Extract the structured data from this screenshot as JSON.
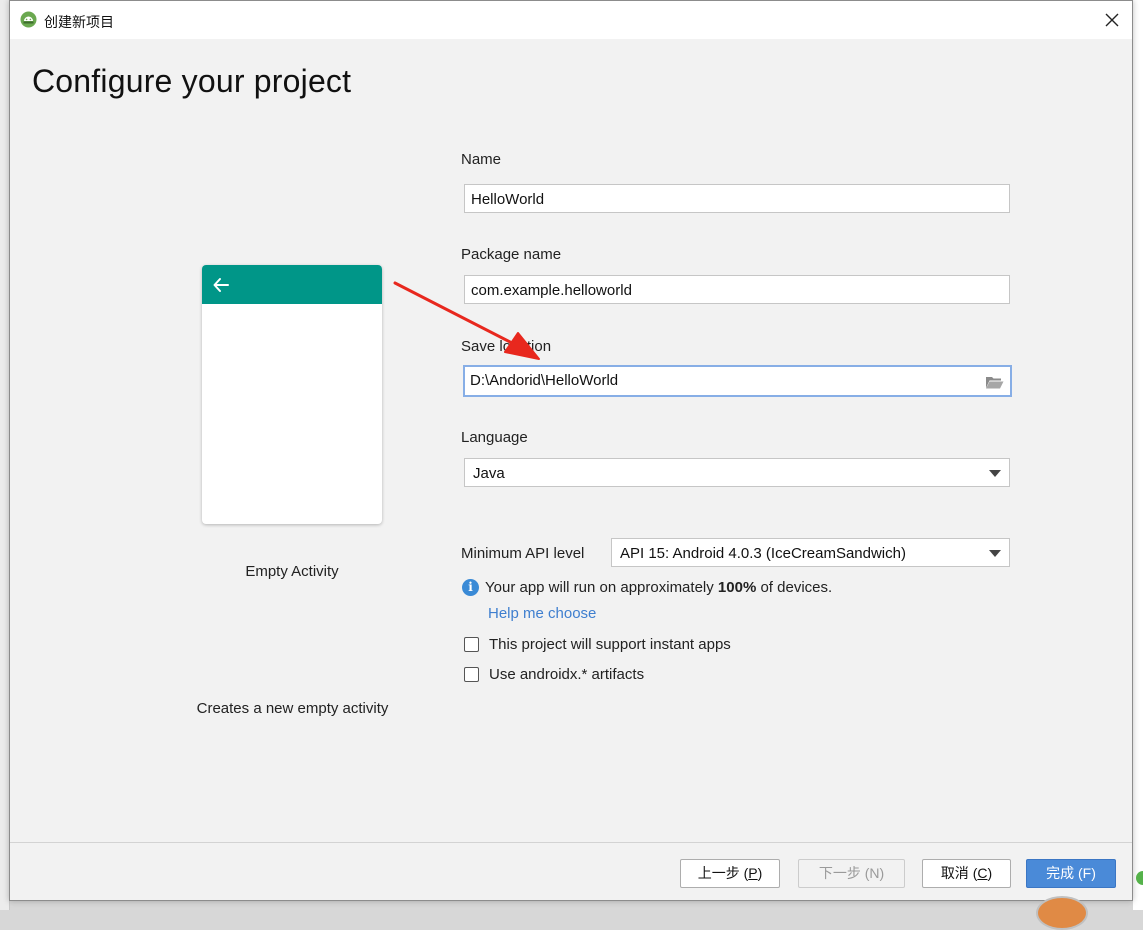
{
  "window": {
    "title": "创建新项目",
    "heading": "Configure your project",
    "close_icon": "close-icon",
    "app_icon": "android-studio-icon"
  },
  "preview": {
    "template_name": "Empty Activity",
    "template_description": "Creates a new empty activity",
    "toolbar_color": "#009688",
    "back_icon": "arrow-left-icon"
  },
  "form": {
    "name_label": "Name",
    "name_value": "HelloWorld",
    "package_label": "Package name",
    "package_value": "com.example.helloworld",
    "location_label": "Save location",
    "location_value": "D:\\Andorid\\HelloWorld",
    "location_icon": "folder-open-icon",
    "language_label": "Language",
    "language_value": "Java",
    "min_api_label": "Minimum API level",
    "min_api_value": "API 15: Android 4.0.3 (IceCreamSandwich)",
    "info_prefix": "Your app will run on approximately ",
    "info_percent": "100%",
    "info_suffix": " of devices.",
    "help_link": "Help me choose",
    "instant_apps_label": "This project will support instant apps",
    "instant_apps_checked": false,
    "androidx_label": "Use androidx.* artifacts",
    "androidx_checked": false
  },
  "buttons": {
    "previous": "上一步 (",
    "previous_key": "P",
    "next": "下一步 (N)",
    "cancel": "取消 (",
    "cancel_key": "C",
    "finish": "完成 (F)"
  },
  "colors": {
    "accent": "#4a8ad8",
    "link": "#3f7fcf",
    "annotation_arrow": "#e8281e"
  }
}
